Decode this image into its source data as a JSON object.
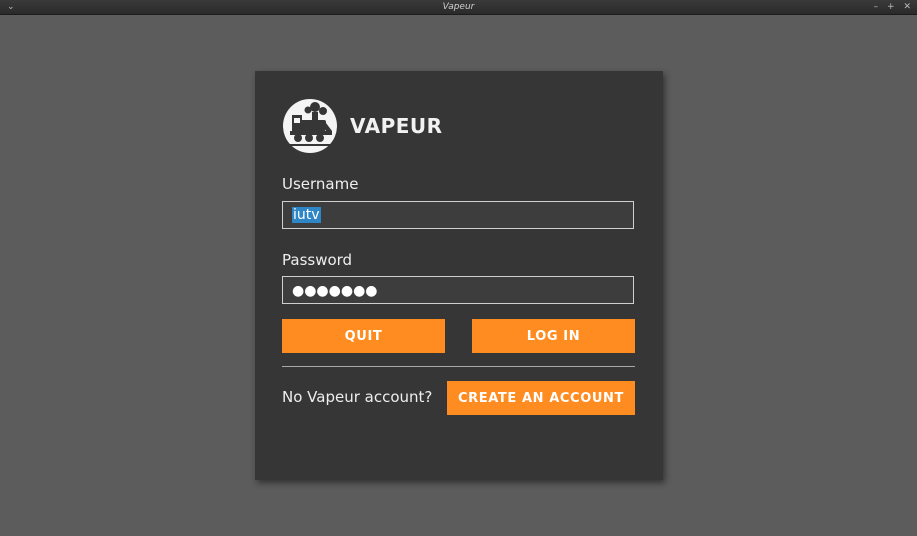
{
  "window": {
    "title": "Vapeur",
    "menu_glyph": "⌄",
    "controls": [
      "–",
      "+",
      "✕"
    ]
  },
  "login": {
    "brand": "VAPEUR",
    "logo_icon": "steam-locomotive-icon",
    "username_label": "Username",
    "username_value": "iutv",
    "password_label": "Password",
    "password_mask": "●●●●●●●",
    "quit_label": "QUIT",
    "login_label": "LOG IN",
    "no_account_text": "No Vapeur account?",
    "create_account_label": "CREATE AN ACCOUNT"
  },
  "colors": {
    "accent": "#ff8c21",
    "dialog_bg": "#363636",
    "window_bg": "#5c5c5c",
    "selection": "#2f86c6"
  }
}
